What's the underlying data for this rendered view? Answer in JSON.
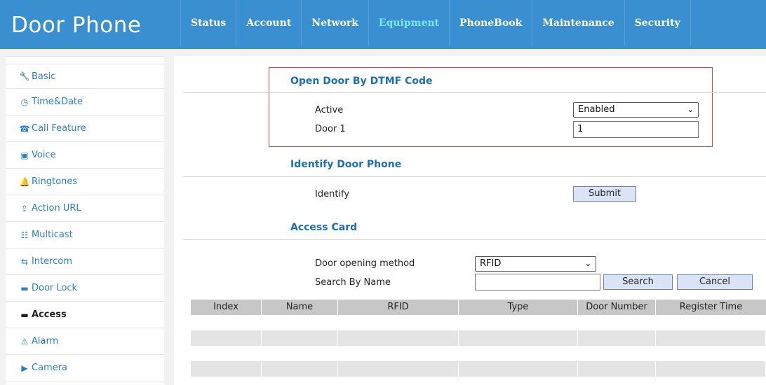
{
  "header": {
    "brand": "Door Phone",
    "nav": [
      "Status",
      "Account",
      "Network",
      "Equipment",
      "PhoneBook",
      "Maintenance",
      "Security"
    ],
    "active_nav": "Equipment"
  },
  "sidebar": {
    "items": [
      {
        "label": "Basic",
        "icon": "wrench-icon"
      },
      {
        "label": "Time&Date",
        "icon": "clock-icon"
      },
      {
        "label": "Call Feature",
        "icon": "phone-icon"
      },
      {
        "label": "Voice",
        "icon": "voicemail-icon"
      },
      {
        "label": "Ringtones",
        "icon": "bell-icon"
      },
      {
        "label": "Action URL",
        "icon": "upload-icon"
      },
      {
        "label": "Multicast",
        "icon": "group-icon"
      },
      {
        "label": "Intercom",
        "icon": "swap-icon"
      },
      {
        "label": "Door Lock",
        "icon": "lock-icon"
      },
      {
        "label": "Access",
        "icon": "card-icon"
      },
      {
        "label": "Alarm",
        "icon": "warning-icon"
      },
      {
        "label": "Camera",
        "icon": "video-icon"
      }
    ],
    "active": "Access"
  },
  "dtmf": {
    "title": "Open Door By DTMF Code",
    "active_label": "Active",
    "active_value": "Enabled",
    "door1_label": "Door 1",
    "door1_value": "1"
  },
  "identify": {
    "title": "Identify Door Phone",
    "label": "Identify",
    "button": "Submit"
  },
  "access_card": {
    "title": "Access Card",
    "method_label": "Door opening method",
    "method_value": "RFID",
    "search_label": "Search By Name",
    "search_value": "",
    "search_button": "Search",
    "cancel_button": "Cancel"
  },
  "table": {
    "columns": [
      "Index",
      "Name",
      "RFID",
      "Type",
      "Door Number",
      "Register Time"
    ]
  },
  "colors": {
    "header_bg": "#3a8fd0",
    "active_nav": "#7be8ff",
    "link": "#2a7fc4",
    "highlight_border": "#d9433d"
  }
}
